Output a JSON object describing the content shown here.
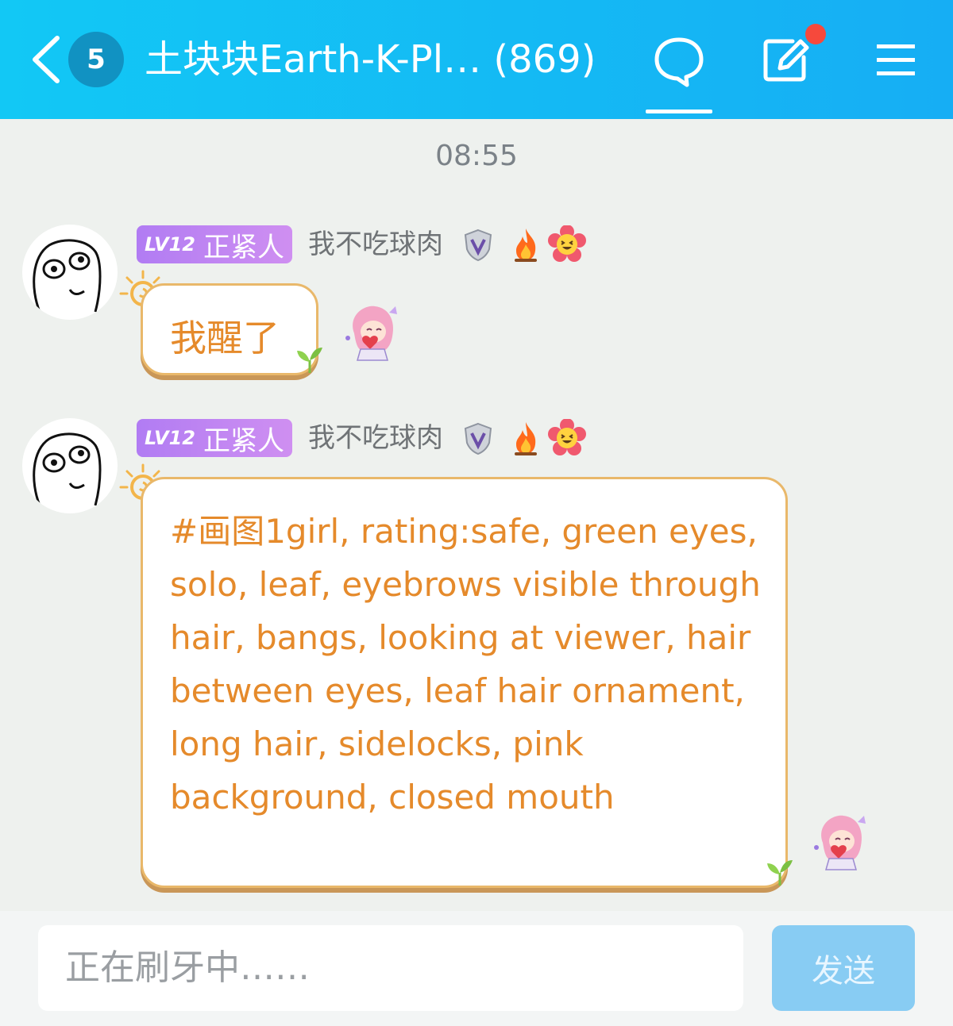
{
  "header": {
    "unread_count": "5",
    "title": "土块块Earth-K-Pl… (869)",
    "colors": {
      "bar": "#16aef4",
      "badge": "#1192c2",
      "notify_dot": "#f6493c"
    }
  },
  "timestamp": "08:55",
  "messages": [
    {
      "level": "LV12",
      "level_title": "正紧人",
      "nickname": "我不吃球肉",
      "badges": [
        "shield-v-icon",
        "fire-icon",
        "flower-emoji-icon"
      ],
      "text": "我醒了",
      "sticker": "pink-hair-girl-sticker"
    },
    {
      "level": "LV12",
      "level_title": "正紧人",
      "nickname": "我不吃球肉",
      "badges": [
        "shield-v-icon",
        "fire-icon",
        "flower-emoji-icon"
      ],
      "text": "#画图1girl, rating:safe, green eyes, solo, leaf, eyebrows visible through hair, bangs, looking at viewer, hair between eyes, leaf hair ornament, long hair, sidelocks, pink background, closed mouth",
      "sticker": "pink-hair-girl-sticker"
    }
  ],
  "input": {
    "value": "正在刷牙中……",
    "send_label": "发送"
  },
  "colors": {
    "bubble_text": "#e58a2b",
    "bubble_border": "#e9b86a",
    "level_tag": "#b17cf3"
  }
}
